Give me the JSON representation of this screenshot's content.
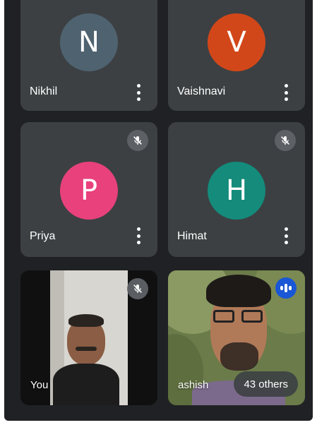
{
  "participants": [
    {
      "name": "Nikhil",
      "initial": "N",
      "color": "#4f6270",
      "muted": false
    },
    {
      "name": "Vaishnavi",
      "initial": "V",
      "color": "#d24719",
      "muted": false
    },
    {
      "name": "Priya",
      "initial": "P",
      "color": "#e8417b",
      "muted": true
    },
    {
      "name": "Himat",
      "initial": "H",
      "color": "#148b7b",
      "muted": true
    },
    {
      "name": "You",
      "muted": true,
      "video": true
    },
    {
      "name": "ashish",
      "speaking": true,
      "video": true
    }
  ],
  "others_label": "43 others",
  "icons": {
    "mute": "mic-off-icon",
    "menu": "more-vert-icon",
    "speaking": "audio-level-icon"
  }
}
